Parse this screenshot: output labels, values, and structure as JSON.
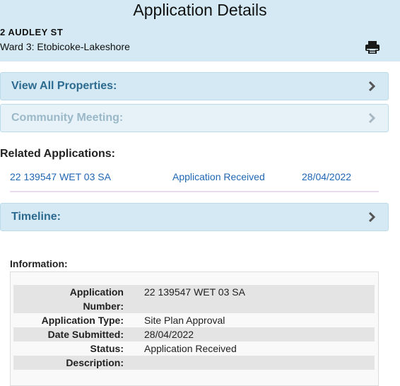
{
  "header": {
    "title": "Application Details",
    "address": "2 AUDLEY ST",
    "ward": "Ward 3: Etobicoke-Lakeshore",
    "print_icon": "print-icon"
  },
  "panels": {
    "view_all": {
      "label": "View All Properties:",
      "icon": "chevron-right-icon"
    },
    "community": {
      "label": "Community Meeting:",
      "icon": "chevron-right-icon"
    },
    "timeline": {
      "label": "Timeline:",
      "icon": "chevron-right-icon"
    }
  },
  "related": {
    "title": "Related Applications:",
    "rows": [
      {
        "number": "22 139547 WET 03 SA",
        "status": "Application Received",
        "date": "28/04/2022"
      }
    ]
  },
  "information": {
    "label": "Information:",
    "fields": [
      {
        "key_line1": "Application",
        "key_line2": "Number:",
        "value": "22 139547 WET 03 SA"
      },
      {
        "key": "Application Type:",
        "value": "Site Plan Approval"
      },
      {
        "key": "Date Submitted:",
        "value": "28/04/2022"
      },
      {
        "key": "Status:",
        "value": "Application Received"
      },
      {
        "key": "Description:",
        "value": ""
      }
    ]
  },
  "colors": {
    "header_bg": "#d4e9f3",
    "panel_text": "#2c6a90",
    "link": "#1f66b3"
  }
}
